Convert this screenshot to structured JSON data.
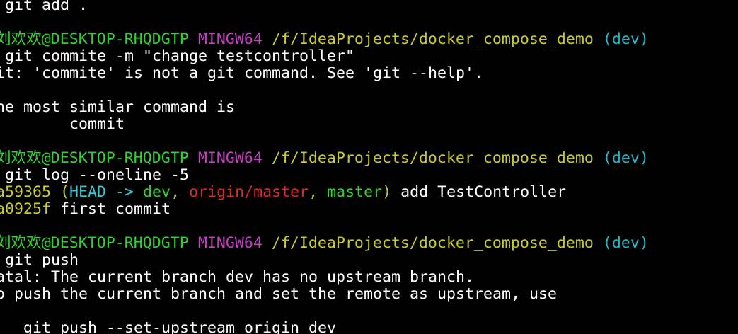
{
  "colors": {
    "background": "#000000",
    "default": "#ffffff",
    "user_host": "#2fd02f",
    "msystem": "#c040c0",
    "path": "#c8c832",
    "branch": "#20b8c8",
    "commit_hash": "#c8c832",
    "head": "#30c8d8",
    "local_branch": "#2fd02f",
    "remote_branch": "#e02828"
  },
  "lines": [
    [
      {
        "text": " git add .",
        "color": "default"
      }
    ],
    [],
    [
      {
        "text": "刘欢欢@DESKTOP-RHQDGTP",
        "color": "user_host"
      },
      {
        "text": " ",
        "color": "default"
      },
      {
        "text": "MINGW64",
        "color": "msystem"
      },
      {
        "text": " ",
        "color": "default"
      },
      {
        "text": "/f/IdeaProjects/docker_compose_demo",
        "color": "path"
      },
      {
        "text": " ",
        "color": "default"
      },
      {
        "text": "(dev)",
        "color": "branch"
      }
    ],
    [
      {
        "text": " git commite -m \"change testcontroller\"",
        "color": "default"
      }
    ],
    [
      {
        "text": "it: 'commite' is not a git command. See 'git --help'.",
        "color": "default"
      }
    ],
    [],
    [
      {
        "text": "he most similar command is",
        "color": "default"
      }
    ],
    [
      {
        "text": "        commit",
        "color": "default"
      }
    ],
    [],
    [
      {
        "text": "刘欢欢@DESKTOP-RHQDGTP",
        "color": "user_host"
      },
      {
        "text": " ",
        "color": "default"
      },
      {
        "text": "MINGW64",
        "color": "msystem"
      },
      {
        "text": " ",
        "color": "default"
      },
      {
        "text": "/f/IdeaProjects/docker_compose_demo",
        "color": "path"
      },
      {
        "text": " ",
        "color": "default"
      },
      {
        "text": "(dev)",
        "color": "branch"
      }
    ],
    [
      {
        "text": " git log --oneline -5",
        "color": "default"
      }
    ],
    [
      {
        "text": "a59365",
        "color": "commit_hash"
      },
      {
        "text": " (",
        "color": "commit_hash"
      },
      {
        "text": "HEAD -> ",
        "color": "head"
      },
      {
        "text": "dev",
        "color": "local_branch"
      },
      {
        "text": ", ",
        "color": "commit_hash"
      },
      {
        "text": "origin/master",
        "color": "remote_branch"
      },
      {
        "text": ", ",
        "color": "commit_hash"
      },
      {
        "text": "master",
        "color": "local_branch"
      },
      {
        "text": ")",
        "color": "commit_hash"
      },
      {
        "text": " add TestController",
        "color": "default"
      }
    ],
    [
      {
        "text": "a0925f",
        "color": "commit_hash"
      },
      {
        "text": " first commit",
        "color": "default"
      }
    ],
    [],
    [
      {
        "text": "刘欢欢@DESKTOP-RHQDGTP",
        "color": "user_host"
      },
      {
        "text": " ",
        "color": "default"
      },
      {
        "text": "MINGW64",
        "color": "msystem"
      },
      {
        "text": " ",
        "color": "default"
      },
      {
        "text": "/f/IdeaProjects/docker_compose_demo",
        "color": "path"
      },
      {
        "text": " ",
        "color": "default"
      },
      {
        "text": "(dev)",
        "color": "branch"
      }
    ],
    [
      {
        "text": " git push",
        "color": "default"
      }
    ],
    [
      {
        "text": "atal: The current branch dev has no upstream branch.",
        "color": "default"
      }
    ],
    [
      {
        "text": "o push the current branch and set the remote as upstream, use",
        "color": "default"
      }
    ],
    [],
    [
      {
        "text": "   git push --set-upstream origin dev",
        "color": "default"
      }
    ]
  ]
}
